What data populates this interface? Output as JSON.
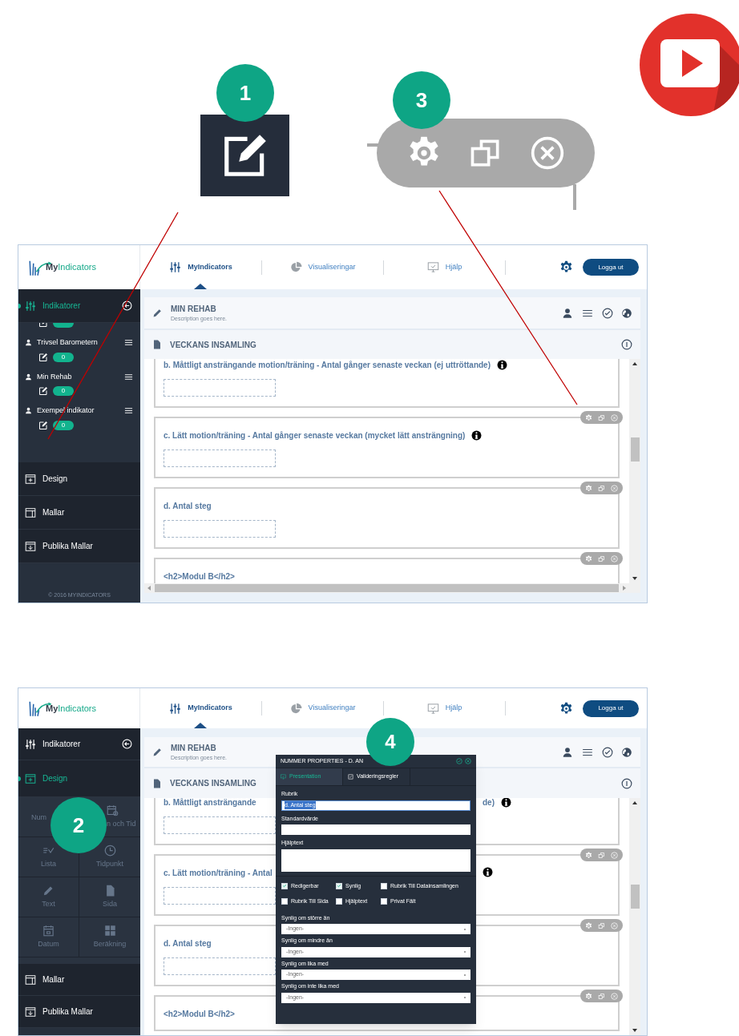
{
  "callouts": [
    {
      "number": "1",
      "kind": "edit"
    },
    {
      "number": "3",
      "kind": "toolbar"
    }
  ],
  "shots": [
    {
      "logo": {
        "prefix": "My",
        "suffix": "Indicators"
      },
      "nav": [
        {
          "label": "MyIndicators",
          "kind": "sliders",
          "selected": true
        },
        {
          "label": "Visualiseringar",
          "kind": "pie",
          "selected": false
        },
        {
          "label": "Hjälp",
          "kind": "monitor",
          "selected": false
        }
      ],
      "logout": "Logga ut",
      "sidebar": {
        "sections": [
          {
            "label": "Indikatorer",
            "kind": "indicators",
            "selected": true,
            "items": [
              {
                "kind": "partial"
              },
              {
                "kind": "indicator",
                "name": "Trivsel Barometern",
                "count": "0"
              },
              {
                "kind": "indicator",
                "name": "Min Rehab",
                "count": "0"
              },
              {
                "kind": "indicator",
                "name": "Exempel indikator",
                "count": "0"
              }
            ]
          },
          {
            "label": "Design",
            "kind": "design",
            "selected": false
          },
          {
            "label": "Mallar",
            "kind": "templates",
            "selected": false
          },
          {
            "label": "Publika Mallar",
            "kind": "public",
            "selected": false
          }
        ],
        "footer": "© 2016 MYINDICATORS"
      },
      "form": {
        "title": "MIN REHAB",
        "description": "Description goes here.",
        "section": "VECKANS INSAMLING",
        "questions": [
          {
            "text": "b. Måttligt ansträngande motion/träning - Antal gånger senaste veckan (ej uttröttande)",
            "info": true,
            "input": true,
            "cut_top": true
          },
          {
            "text": "c. Lätt motion/träning - Antal gånger senaste veckan (mycket lätt ansträngning)",
            "info": true,
            "input": true,
            "cut_top": false
          },
          {
            "text": "d. Antal steg",
            "info": false,
            "input": true,
            "cut_top": false
          },
          {
            "text": "<h2>Modul B</h2>",
            "info": false,
            "input": false,
            "cut_top": false
          }
        ]
      }
    },
    {
      "logo": {
        "prefix": "My",
        "suffix": "Indicators"
      },
      "nav": [
        {
          "label": "MyIndicators",
          "kind": "sliders",
          "selected": true
        },
        {
          "label": "Visualiseringar",
          "kind": "pie",
          "selected": false
        },
        {
          "label": "Hjälp",
          "kind": "monitor",
          "selected": false
        }
      ],
      "logout": "Logga ut",
      "sidebar": {
        "sections": [
          {
            "label": "Indikatorer",
            "kind": "indicators",
            "selected": false
          },
          {
            "label": "Design",
            "kind": "design",
            "selected": true,
            "tools": [
              {
                "label": "Num",
                "kind": "number"
              },
              {
                "label": "n och Tid",
                "kind": "datetime"
              },
              {
                "label": "Lista",
                "kind": "list"
              },
              {
                "label": "Tidpunkt",
                "kind": "clock"
              },
              {
                "label": "Text",
                "kind": "pencil"
              },
              {
                "label": "Sida",
                "kind": "page"
              },
              {
                "label": "Datum",
                "kind": "calendar"
              },
              {
                "label": "Beräkning",
                "kind": "grid"
              }
            ]
          },
          {
            "label": "Mallar",
            "kind": "templates",
            "selected": false
          },
          {
            "label": "Publika Mallar",
            "kind": "public",
            "selected": false
          }
        ]
      },
      "form": {
        "title": "MIN REHAB",
        "description": "Description goes here.",
        "section": "VECKANS INSAMLING",
        "questions": [
          {
            "text": "b. Måttligt ansträngande",
            "info": false,
            "input": true,
            "cut_top": true,
            "after_modal": {
              "text": "de)",
              "info": true
            }
          },
          {
            "text": "c. Lätt motion/träning - Antal",
            "info": false,
            "input": true,
            "cut_top": false,
            "after_modal": {
              "info": true
            }
          },
          {
            "text": "d. Antal steg",
            "info": false,
            "input": true,
            "cut_top": false
          },
          {
            "text": "<h2>Modul B</h2>",
            "info": false,
            "input": false,
            "cut_top": false
          }
        ]
      },
      "modal": {
        "title": "NUMMER PROPERTIES - D. AN",
        "tabs": [
          {
            "label": "Presentation",
            "kind": "monitor",
            "selected": true
          },
          {
            "label": "Valideringsregler",
            "kind": "checkbox",
            "selected": false
          }
        ],
        "fields": [
          {
            "label": "Rubrik",
            "kind": "text",
            "value": "d. Antal steg",
            "highlighted": true
          },
          {
            "label": "Standardvärde",
            "kind": "text",
            "highlighted": false
          },
          {
            "label": "Hjälptext",
            "kind": "textarea",
            "highlighted": false
          }
        ],
        "checkboxes": [
          {
            "label": "Redigerbar",
            "checked": true
          },
          {
            "label": "Synlig",
            "checked": true
          },
          {
            "label": "Rubrik Till Datainsamlingen",
            "checked": false
          },
          {
            "label": "Rubrik Till Sida",
            "checked": false
          },
          {
            "label": "Hjälptext",
            "checked": false
          },
          {
            "label": "Privat Fält",
            "checked": false
          }
        ],
        "selects": [
          {
            "label": "Synlig om större än",
            "value": "-Ingen-"
          },
          {
            "label": "Synlig om mindre än",
            "value": "-Ingen-"
          },
          {
            "label": "Synlig om lika med",
            "value": "-Ingen-"
          },
          {
            "label": "Synlig om inte lika med",
            "value": "-Ingen-"
          }
        ]
      },
      "badges": [
        {
          "number": "2",
          "kind": "sidebar"
        },
        {
          "number": "4",
          "kind": "modal"
        }
      ]
    }
  ]
}
